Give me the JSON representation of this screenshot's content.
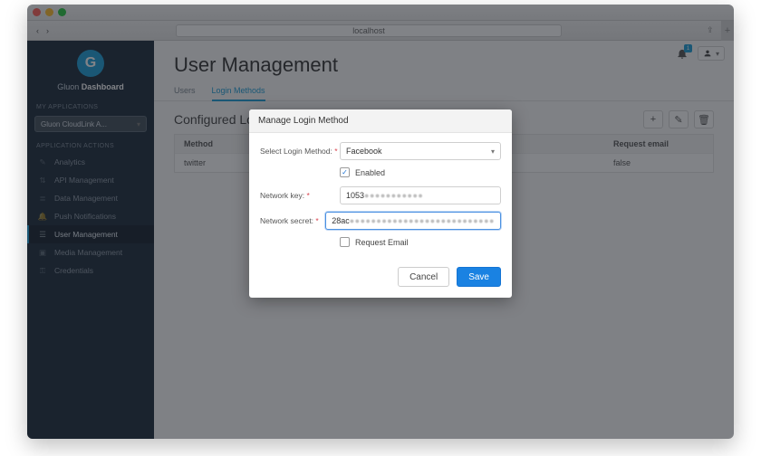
{
  "browser": {
    "url": "localhost",
    "back_icon": "‹",
    "fwd_icon": "›"
  },
  "brand": {
    "logo_letter": "G",
    "name_pre": "Gluon ",
    "name_bold": "Dashboard"
  },
  "sidebar": {
    "section_apps": "MY APPLICATIONS",
    "app_selected": "Gluon CloudLink A...",
    "section_actions": "APPLICATION ACTIONS",
    "items": [
      {
        "label": "Analytics"
      },
      {
        "label": "API Management"
      },
      {
        "label": "Data Management"
      },
      {
        "label": "Push Notifications"
      },
      {
        "label": "User Management"
      },
      {
        "label": "Media Management"
      },
      {
        "label": "Credentials"
      }
    ]
  },
  "topbar": {
    "notif_count": "1"
  },
  "page": {
    "title": "User Management",
    "tabs": [
      {
        "label": "Users"
      },
      {
        "label": "Login Methods"
      }
    ],
    "section_title": "Configured Login Methods"
  },
  "table": {
    "head": {
      "c1": "Method",
      "c2": "",
      "c3": "Request email"
    },
    "rows": [
      {
        "c1": "twitter",
        "c2": "",
        "c3": "false"
      }
    ]
  },
  "dialog": {
    "title": "Manage Login Method",
    "labels": {
      "select": "Select Login Method:",
      "enabled": "Enabled",
      "key": "Network key:",
      "secret": "Network secret:",
      "request": "Request Email"
    },
    "values": {
      "method": "Facebook",
      "enabled": true,
      "key_clear": "1053",
      "key_blur": "●●●●●●●●●●●",
      "secret_clear": "28ac",
      "secret_blur": "●●●●●●●●●●●●●●●●●●●●●●●●●●●",
      "request": false
    },
    "buttons": {
      "cancel": "Cancel",
      "save": "Save"
    }
  }
}
